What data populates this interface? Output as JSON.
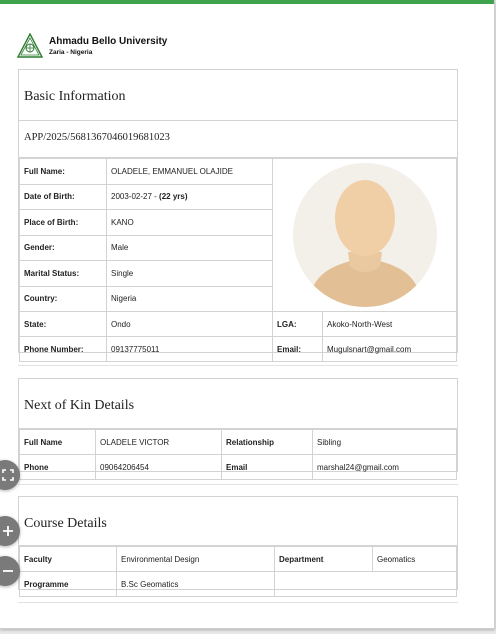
{
  "header": {
    "university": "Ahmadu Bello University",
    "location": "Zaria - Nigeria",
    "logo_icon": "university-crest-icon"
  },
  "basic": {
    "title": "Basic Information",
    "app_no": "APP/2025/5681367046019681023",
    "rows": [
      {
        "label": "Full Name:",
        "value": "OLADELE, EMMANUEL OLAJIDE"
      },
      {
        "label": "Date of Birth:",
        "value": "2003-02-27 - ",
        "value_bold": "(22 yrs)"
      },
      {
        "label": "Place of Birth:",
        "value": "KANO"
      },
      {
        "label": "Gender:",
        "value": "Male"
      },
      {
        "label": "Marital Status:",
        "value": "Single"
      },
      {
        "label": "Country:",
        "value": "Nigeria"
      }
    ],
    "state_label": "State:",
    "state": "Ondo",
    "lga_label": "LGA:",
    "lga": "Akoko-North-West",
    "phone_label": "Phone Number:",
    "phone": "09137775011",
    "email_label": "Email:",
    "email": "Mugulsnart@gmail.com",
    "photo_icon": "avatar-placeholder-icon"
  },
  "kin": {
    "title": "Next of Kin Details",
    "fullname_label": "Full Name",
    "fullname": "OLADELE VICTOR",
    "relationship_label": "Relationship",
    "relationship": "Sibling",
    "phone_label": "Phone",
    "phone": "09064206454",
    "email_label": "Email",
    "email": "marshal24@gmail.com"
  },
  "course": {
    "title": "Course Details",
    "faculty_label": "Faculty",
    "faculty": "Environmental Design",
    "department_label": "Department",
    "department": "Geomatics",
    "programme_label": "Programme",
    "programme": "B.Sc Geomatics"
  },
  "controls": {
    "fullscreen_icon": "fullscreen-icon",
    "zoom_in_icon": "plus-icon",
    "zoom_out_icon": "minus-icon"
  },
  "colors": {
    "accent": "#3fa34d",
    "control": "#7a7a7a"
  }
}
